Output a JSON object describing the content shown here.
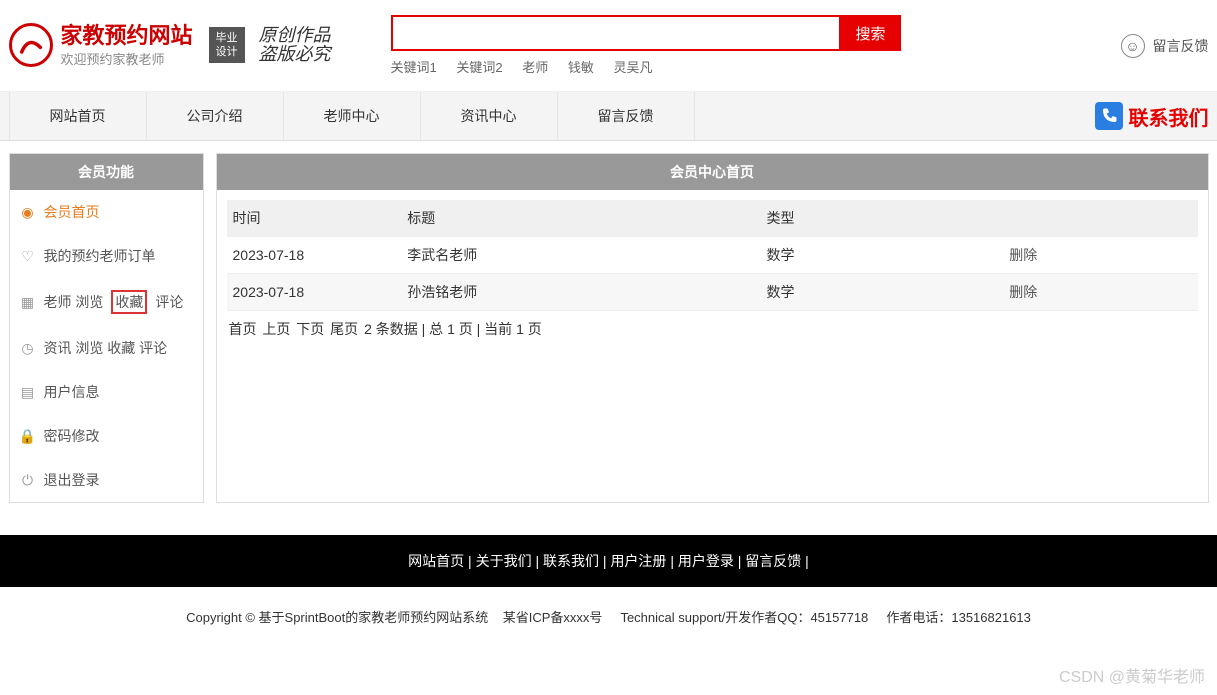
{
  "header": {
    "logo_title": "家教预约网站",
    "logo_sub": "欢迎预约家教老师",
    "badge_line1": "毕业",
    "badge_line2": "设计",
    "calligraphy_line1": "原创作品",
    "calligraphy_line2": "盗版必究",
    "search_placeholder": "",
    "search_btn": "搜索",
    "keywords": [
      "关键词1",
      "关键词2",
      "老师",
      "钱敏",
      "灵吴凡"
    ],
    "feedback_label": "留言反馈"
  },
  "nav": {
    "items": [
      "网站首页",
      "公司介绍",
      "老师中心",
      "资讯中心",
      "留言反馈"
    ],
    "contact": "联系我们"
  },
  "sidebar": {
    "title": "会员功能",
    "items": [
      {
        "label": "会员首页",
        "icon": "home",
        "active": true
      },
      {
        "label": "我的预约老师订单",
        "icon": "heart"
      },
      {
        "label_parts": [
          "老师 浏览",
          " 收藏 ",
          "评论"
        ],
        "icon": "grid",
        "highlight_middle": true
      },
      {
        "label": "资讯 浏览 收藏 评论",
        "icon": "clock"
      },
      {
        "label": "用户信息",
        "icon": "doc"
      },
      {
        "label": "密码修改",
        "icon": "lock"
      },
      {
        "label": "退出登录",
        "icon": "power"
      }
    ]
  },
  "content": {
    "title": "会员中心首页",
    "columns": [
      "时间",
      "标题",
      "类型",
      ""
    ],
    "rows": [
      {
        "time": "2023-07-18",
        "title": "李武名老师",
        "type": "数学",
        "action": "删除"
      },
      {
        "time": "2023-07-18",
        "title": "孙浩铭老师",
        "type": "数学",
        "action": "删除"
      }
    ],
    "pager": {
      "first": "首页",
      "prev": "上页",
      "next": "下页",
      "last": "尾页",
      "total_records": "2",
      "records_label_prefix": " 条数据 | 总 ",
      "total_pages": "1",
      "pages_label": " 页 | 当前 ",
      "current_page": "1",
      "page_suffix": " 页"
    }
  },
  "footer": {
    "nav": [
      "网站首页",
      "关于我们",
      "联系我们",
      "用户注册",
      "用户登录",
      "留言反馈"
    ],
    "sep": "  |  ",
    "copyright_prefix": "Copyright © 基于SprintBoot的家教老师预约网站系统",
    "icp": "某省ICP备xxxx号",
    "support": "Technical support/开发作者QQ：45157718",
    "phone": "作者电话：13516821613"
  },
  "watermark": "CSDN @黄菊华老师"
}
